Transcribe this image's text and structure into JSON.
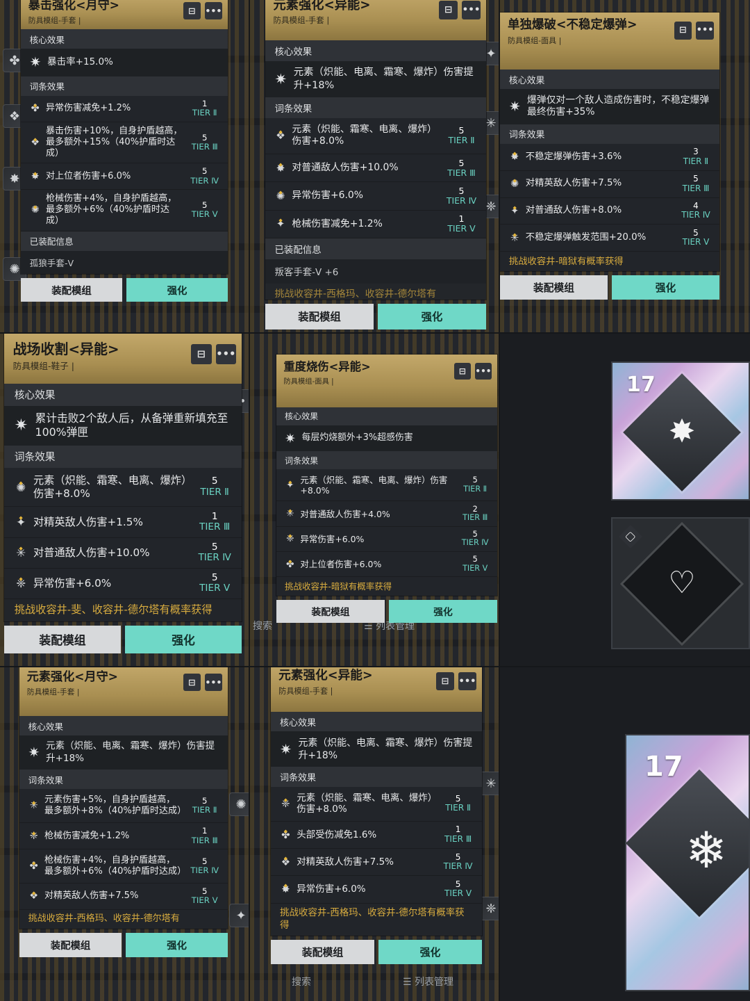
{
  "labels": {
    "core": "核心效果",
    "affix": "词条效果",
    "equipped": "已装配信息",
    "equip_btn": "装配模组",
    "upgrade_btn": "强化",
    "search": "搜索",
    "list_mgmt": "列表管理"
  },
  "cards": [
    {
      "title": "暴击强化<月守>",
      "subtitle": "防具模组-手套 |",
      "core": "暴击率+15.0%",
      "stats": [
        {
          "text": "异常伤害减免+1.2%",
          "count": "1",
          "tier": "TIER Ⅱ"
        },
        {
          "text": "暴击伤害+10%，自身护盾越高，最多额外+15%（40%护盾时达成）",
          "count": "5",
          "tier": "TIER Ⅲ"
        },
        {
          "text": "对上位者伤害+6.0%",
          "count": "5",
          "tier": "TIER Ⅳ"
        },
        {
          "text": "枪械伤害+4%，自身护盾越高，最多额外+6%（40%护盾时达成）",
          "count": "5",
          "tier": "TIER Ⅴ"
        }
      ],
      "equipped_value": "孤狼手套-V"
    },
    {
      "title": "元素强化<异能>",
      "subtitle": "防具模组-手套 |",
      "core": "元素（炽能、电离、霜寒、爆炸）伤害提升+18%",
      "stats": [
        {
          "text": "元素（炽能、霜寒、电离、爆炸）伤害+8.0%",
          "count": "5",
          "tier": "TIER Ⅱ"
        },
        {
          "text": "对普通敌人伤害+10.0%",
          "count": "5",
          "tier": "TIER Ⅲ"
        },
        {
          "text": "异常伤害+6.0%",
          "count": "5",
          "tier": "TIER Ⅳ"
        },
        {
          "text": "枪械伤害减免+1.2%",
          "count": "1",
          "tier": "TIER Ⅴ"
        }
      ],
      "equipped_value": "叛客手套-V +6",
      "source": "挑战收容井-西格玛、收容井-德尔塔有"
    },
    {
      "title": "单独爆破<不稳定爆弹>",
      "subtitle": "防具模组-面具 |",
      "core": "爆弹仅对一个敌人造成伤害时，不稳定爆弹最终伤害+35%",
      "stats": [
        {
          "text": "不稳定爆弹伤害+3.6%",
          "count": "3",
          "tier": "TIER Ⅱ"
        },
        {
          "text": "对精英敌人伤害+7.5%",
          "count": "5",
          "tier": "TIER Ⅲ"
        },
        {
          "text": "对普通敌人伤害+8.0%",
          "count": "4",
          "tier": "TIER Ⅳ"
        },
        {
          "text": "不稳定爆弹触发范围+20.0%",
          "count": "5",
          "tier": "TIER Ⅴ"
        }
      ],
      "source": "挑战收容井-暗狱有概率获得"
    },
    {
      "title": "战场收割<异能>",
      "subtitle": "防具模组-鞋子 |",
      "core": "累计击败2个敌人后，从备弹重新填充至100%弹匣",
      "stats": [
        {
          "text": "元素（炽能、霜寒、电离、爆炸）伤害+8.0%",
          "count": "5",
          "tier": "TIER Ⅱ"
        },
        {
          "text": "对精英敌人伤害+1.5%",
          "count": "1",
          "tier": "TIER Ⅲ"
        },
        {
          "text": "对普通敌人伤害+10.0%",
          "count": "5",
          "tier": "TIER Ⅳ"
        },
        {
          "text": "异常伤害+6.0%",
          "count": "5",
          "tier": "TIER Ⅴ"
        }
      ],
      "source": "挑战收容井-斐、收容井-德尔塔有概率获得"
    },
    {
      "title": "重度烧伤<异能>",
      "subtitle": "防具模组-面具 |",
      "core": "每层灼烧额外+3%超感伤害",
      "stats": [
        {
          "text": "元素（炽能、霜寒、电离、爆炸）伤害+8.0%",
          "count": "5",
          "tier": "TIER Ⅱ"
        },
        {
          "text": "对普通敌人伤害+4.0%",
          "count": "2",
          "tier": "TIER Ⅲ"
        },
        {
          "text": "异常伤害+6.0%",
          "count": "5",
          "tier": "TIER Ⅳ"
        },
        {
          "text": "对上位者伤害+6.0%",
          "count": "5",
          "tier": "TIER Ⅴ"
        }
      ],
      "source": "挑战收容井-暗狱有概率获得"
    },
    {
      "title": "元素强化<月守>",
      "subtitle": "防具模组-手套 |",
      "core": "元素（炽能、电离、霜寒、爆炸）伤害提升+18%",
      "stats": [
        {
          "text": "元素伤害+5%，自身护盾越高，最多额外+8%（40%护盾时达成）",
          "count": "5",
          "tier": "TIER Ⅱ"
        },
        {
          "text": "枪械伤害减免+1.2%",
          "count": "1",
          "tier": "TIER Ⅲ"
        },
        {
          "text": "枪械伤害+4%，自身护盾越高，最多额外+6%（40%护盾时达成）",
          "count": "5",
          "tier": "TIER Ⅳ"
        },
        {
          "text": "对精英敌人伤害+7.5%",
          "count": "5",
          "tier": "TIER Ⅴ"
        }
      ],
      "source": "挑战收容井-西格玛、收容井-德尔塔有"
    },
    {
      "title": "元素强化<异能>",
      "subtitle": "防具模组-手套 |",
      "core": "元素（炽能、电离、霜寒、爆炸）伤害提升+18%",
      "stats": [
        {
          "text": "元素（炽能、霜寒、电离、爆炸）伤害+8.0%",
          "count": "5",
          "tier": "TIER Ⅱ"
        },
        {
          "text": "头部受伤减免1.6%",
          "count": "1",
          "tier": "TIER Ⅲ"
        },
        {
          "text": "对精英敌人伤害+7.5%",
          "count": "5",
          "tier": "TIER Ⅳ"
        },
        {
          "text": "异常伤害+6.0%",
          "count": "5",
          "tier": "TIER Ⅴ"
        }
      ],
      "source": "挑战收容井-西格玛、收容井-德尔塔有概率获得"
    }
  ],
  "art": {
    "level_top": "17",
    "level_bottom": "17"
  },
  "colors": {
    "gold_header": "#b59a5c",
    "teal_button": "#6fd8c7",
    "tier_text": "#6bd3c3",
    "source_text": "#d8ac3f",
    "panel": "#26292d"
  }
}
